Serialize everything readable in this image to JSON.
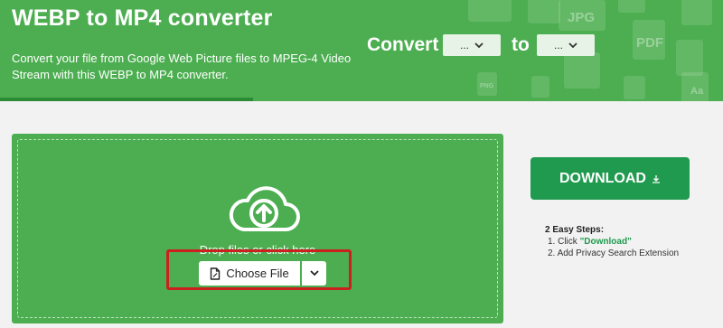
{
  "header": {
    "title": "WEBP to MP4 converter",
    "subtitle": "Convert your file from Google Web Picture files to MPEG-4 Video Stream with this WEBP to MP4 converter.",
    "convert_label": "Convert",
    "to_label": "to",
    "from_select_value": "...",
    "to_select_value": "...",
    "background_icon_labels": [
      "JPG",
      "PDF",
      "Aa",
      "PNG"
    ]
  },
  "dropzone": {
    "drop_text": "Drop files or click here",
    "choose_file_label": "Choose File"
  },
  "download": {
    "label": "DOWNLOAD"
  },
  "steps": {
    "title": "2 Easy Steps:",
    "step1_prefix": "1. Click ",
    "step1_highlight": "\"Download\"",
    "step2": "2. Add Privacy Search Extension"
  },
  "colors": {
    "header_green": "#4cae50",
    "download_green": "#1f9a4e",
    "highlight_red": "#cc1f1f"
  }
}
